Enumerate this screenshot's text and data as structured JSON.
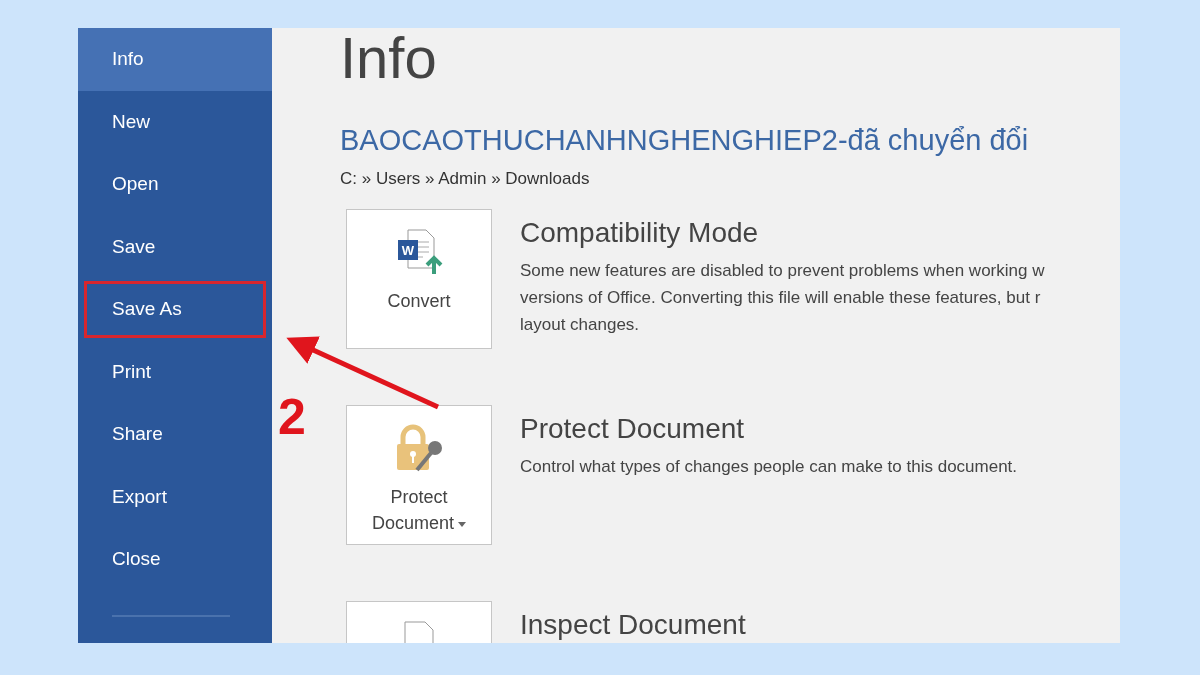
{
  "sidebar": {
    "items": [
      {
        "label": "Info",
        "selected": true,
        "outlined": false
      },
      {
        "label": "New",
        "selected": false,
        "outlined": false
      },
      {
        "label": "Open",
        "selected": false,
        "outlined": false
      },
      {
        "label": "Save",
        "selected": false,
        "outlined": false
      },
      {
        "label": "Save As",
        "selected": false,
        "outlined": true
      },
      {
        "label": "Print",
        "selected": false,
        "outlined": false
      },
      {
        "label": "Share",
        "selected": false,
        "outlined": false
      },
      {
        "label": "Export",
        "selected": false,
        "outlined": false
      },
      {
        "label": "Close",
        "selected": false,
        "outlined": false
      }
    ]
  },
  "page": {
    "title": "Info",
    "file_name": "BAOCAOTHUCHANHNGHENGHIEP2-đã chuyển đổi",
    "path": "C: » Users » Admin » Downloads"
  },
  "sections": [
    {
      "kind": "convert",
      "icon_letter": "W",
      "button_label": "Convert",
      "has_dropdown": false,
      "title": "Compatibility Mode",
      "description_lines": [
        "Some new features are disabled to prevent problems when working w",
        "versions of Office. Converting this file will enable these features, but r",
        "layout changes."
      ]
    },
    {
      "kind": "protect",
      "button_label": "Protect Document",
      "has_dropdown": true,
      "title": "Protect Document",
      "description_lines": [
        "Control what types of changes people can make to this document."
      ]
    },
    {
      "kind": "inspect",
      "title": "Inspect Document"
    }
  ],
  "annotation": {
    "step_label": "2"
  }
}
